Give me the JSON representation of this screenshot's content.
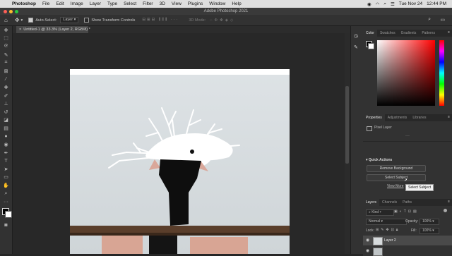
{
  "menubar": {
    "app_name": "Photoshop",
    "items": [
      "File",
      "Edit",
      "Image",
      "Layer",
      "Type",
      "Select",
      "Filter",
      "3D",
      "View",
      "Plugins",
      "Window",
      "Help"
    ],
    "date": "Tue Nov 24",
    "time": "12:44 PM"
  },
  "window": {
    "title": "Adobe Photoshop 2021"
  },
  "options": {
    "auto_select_label": "Auto-Select:",
    "auto_select_value": "Layer",
    "transform_label": "Show Transform Controls",
    "mode_label": "3D Mode:"
  },
  "document": {
    "tab_label": "Untitled-1 @ 33.3% (Layer 2, RGB/8) *"
  },
  "color_panel": {
    "tabs": [
      "Color",
      "Swatches",
      "Gradients",
      "Patterns"
    ],
    "hue_color": "#ff0000"
  },
  "properties_panel": {
    "tabs": [
      "Properties",
      "Adjustments",
      "Libraries"
    ],
    "layer_type": "Pixel Layer",
    "quick_actions_label": "Quick Actions",
    "remove_bg_label": "Remove Background",
    "select_subject_label": "Select Subject",
    "view_more_label": "View More",
    "tooltip": "Select Subject"
  },
  "layers_panel": {
    "tabs": [
      "Layers",
      "Channels",
      "Paths"
    ],
    "kind_label": "Kind",
    "blend_mode": "Normal",
    "opacity_label": "Opacity:",
    "opacity_value": "100%",
    "lock_label": "Lock:",
    "fill_label": "Fill:",
    "fill_value": "100%",
    "layer_name": "Layer 2"
  }
}
